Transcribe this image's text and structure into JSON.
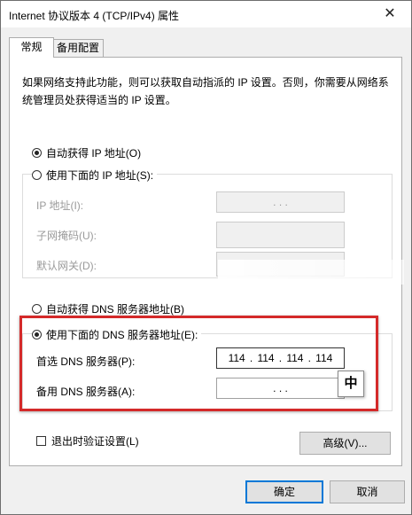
{
  "window": {
    "title": "Internet 协议版本 4 (TCP/IPv4) 属性",
    "close_glyph": "✕"
  },
  "tabs": [
    {
      "label": "常规"
    },
    {
      "label": "备用配置"
    }
  ],
  "description": "如果网络支持此功能，则可以获取自动指派的 IP 设置。否则，你需要从网络系统管理员处获得适当的 IP 设置。",
  "ip": {
    "auto_label": "自动获得 IP 地址(O)",
    "auto_selected": true,
    "manual_label": "使用下面的 IP 地址(S):",
    "manual_selected": false,
    "fields": [
      {
        "label": "IP 地址(I):",
        "value": ".   .   ."
      },
      {
        "label": "子网掩码(U):",
        "value": ""
      },
      {
        "label": "默认网关(D):",
        "value": ""
      }
    ]
  },
  "dns": {
    "auto_label": "自动获得 DNS 服务器地址(B)",
    "auto_selected": false,
    "manual_label": "使用下面的 DNS 服务器地址(E):",
    "manual_selected": true,
    "preferred_label": "首选 DNS 服务器(P):",
    "preferred_value": [
      "114",
      "114",
      "114",
      "114"
    ],
    "alternate_label": "备用 DNS 服务器(A):",
    "alternate_value": ".   .   ."
  },
  "ime_indicator": "中",
  "validate_label": "退出时验证设置(L)",
  "validate_checked": false,
  "advanced_label": "高级(V)...",
  "ok_label": "确定",
  "cancel_label": "取消",
  "colors": {
    "highlight_box": "#d42a2a",
    "default_button_border": "#0078d7"
  }
}
